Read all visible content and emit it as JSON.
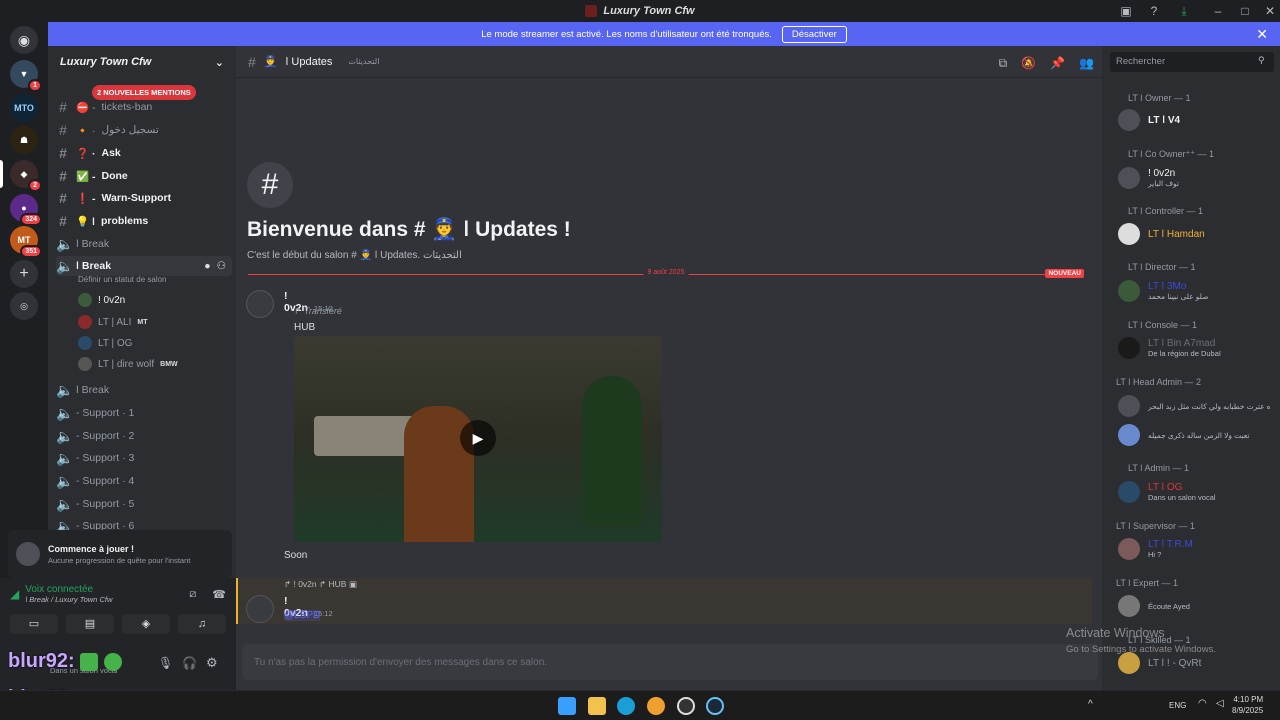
{
  "window": {
    "title": "Luxury Town Cfw"
  },
  "banner": {
    "text": "Le mode streamer est activé. Les noms d'utilisateur ont été tronqués.",
    "button": "Désactiver"
  },
  "servers": [
    {
      "label": "",
      "badge": "1"
    },
    {
      "label": "MTO",
      "badge": ""
    },
    {
      "label": "",
      "badge": ""
    },
    {
      "label": "",
      "badge": "2"
    },
    {
      "label": "",
      "badge": "324"
    },
    {
      "label": "MT",
      "badge": "351"
    }
  ],
  "sidebar": {
    "server_name": "Luxury Town Cfw",
    "mentions_pill": "2 NOUVELLES MENTIONS",
    "channels": [
      {
        "name": "tickets-ban",
        "prefix": "⛔ -"
      },
      {
        "name": "تسجيل دخول",
        "prefix": "🔸 ·"
      },
      {
        "name": "Ask",
        "prefix": "❓ ·"
      },
      {
        "name": "Done",
        "prefix": "✅ -"
      },
      {
        "name": "Warn-Support",
        "prefix": "❗ -"
      },
      {
        "name": "problems",
        "prefix": "💡 ǀ"
      }
    ],
    "voice_break_1": "ǀ Break",
    "voice_break_active": "ǀ Break",
    "voice_status_placeholder": "Définir un statut de salon",
    "voice_users": [
      {
        "name": "ǃ 0v2n",
        "tag": ""
      },
      {
        "name": "LT | ALI",
        "tag": "MT"
      },
      {
        "name": "LT | OG",
        "tag": ""
      },
      {
        "name": "LT | dire wolf",
        "tag": "BMW"
      }
    ],
    "voice_break_2": "ǀ Break",
    "support_channels": [
      "- Support · 1",
      "- Support · 2",
      "- Support · 3",
      "- Support · 4",
      "- Support · 5",
      "- Support · 6"
    ],
    "quest": {
      "title": "Commence à jouer !",
      "subtitle": "Aucune progression de quête pour l'instant"
    },
    "voice_connected": {
      "status": "Voix connectée",
      "location": "ǀ Break / Luxury Town Cfw"
    },
    "user": {
      "name": "blur92:",
      "status": "Dans un salon vocal"
    }
  },
  "chat": {
    "channel_name": "ǀ Updates",
    "channel_topic": "التحديثات",
    "search_placeholder": "Rechercher",
    "welcome_title": "Bienvenue dans # 👮 ǀ Updates !",
    "welcome_sub": "C'est le début du salon # 👮 ǀ Updates. التحديثات",
    "divider_date": "9 août 2025",
    "divider_new": "NOUVEAU",
    "messages": [
      {
        "author": "ǃ 0v2n",
        "time": "15:12",
        "forwarded": "Transféré",
        "text": "HUB",
        "footer": "Soon"
      },
      {
        "reply_author": "ǃ 0v2n",
        "reply_text": "HUB",
        "author": "ǃ 0v2n",
        "time": "15:12",
        "text": "@LSPD"
      }
    ],
    "input_placeholder": "Tu n'as pas la permission d'envoyer des messages dans ce salon."
  },
  "members": {
    "groups": [
      {
        "title": "LT ǀ Owner — 1",
        "members": [
          {
            "name": "LT ǀ V4",
            "status": ""
          }
        ]
      },
      {
        "title": "LT ǀ Co Owner⁺⁺ — 1",
        "members": [
          {
            "name": "ǃ 0v2n",
            "status": "توف الباير"
          }
        ]
      },
      {
        "title": "LT ǀ Controller — 1",
        "members": [
          {
            "name": "LT ǀ Hamdan",
            "status": ""
          }
        ]
      },
      {
        "title": "LT ǀ Director — 1",
        "members": [
          {
            "name": "LT ǀ 3Mo",
            "status": "صلو على نبينا محمد"
          }
        ]
      },
      {
        "title": "LT ǀ Console — 1",
        "members": [
          {
            "name": "LT ǀ Bin A7mad",
            "status": "De la région de Dubaï"
          }
        ]
      },
      {
        "title": "LT ǀ Head Admin — 2",
        "members": [
          {
            "name": "",
            "status": "ه عترت خطبابه ولي كانت مثل زبد البحر"
          },
          {
            "name": "",
            "status": "تعبت ولا الزمن ساله ذكرى جميله"
          }
        ]
      },
      {
        "title": "LT ǀ Admin — 1",
        "members": [
          {
            "name": "LT ǀ OG",
            "status": "Dans un salon vocal"
          }
        ]
      },
      {
        "title": "LT ǀ Supervisor — 1",
        "members": [
          {
            "name": "LT ǀ T.R.M",
            "status": "Hi ?"
          }
        ]
      },
      {
        "title": "LT ǀ Expert — 1",
        "members": [
          {
            "name": "",
            "status": "Écoute Ayed"
          }
        ]
      },
      {
        "title": "LT ǀ Skilled — 1",
        "members": [
          {
            "name": "LT ǀ ǃ - QvRt",
            "status": ""
          }
        ]
      }
    ]
  },
  "watermark": {
    "activate_title": "Activate Windows",
    "activate_sub": "Go to Settings to activate Windows."
  },
  "taskbar": {
    "lang": "ENG",
    "time": "4:10 PM",
    "date": "8/9/2025"
  }
}
